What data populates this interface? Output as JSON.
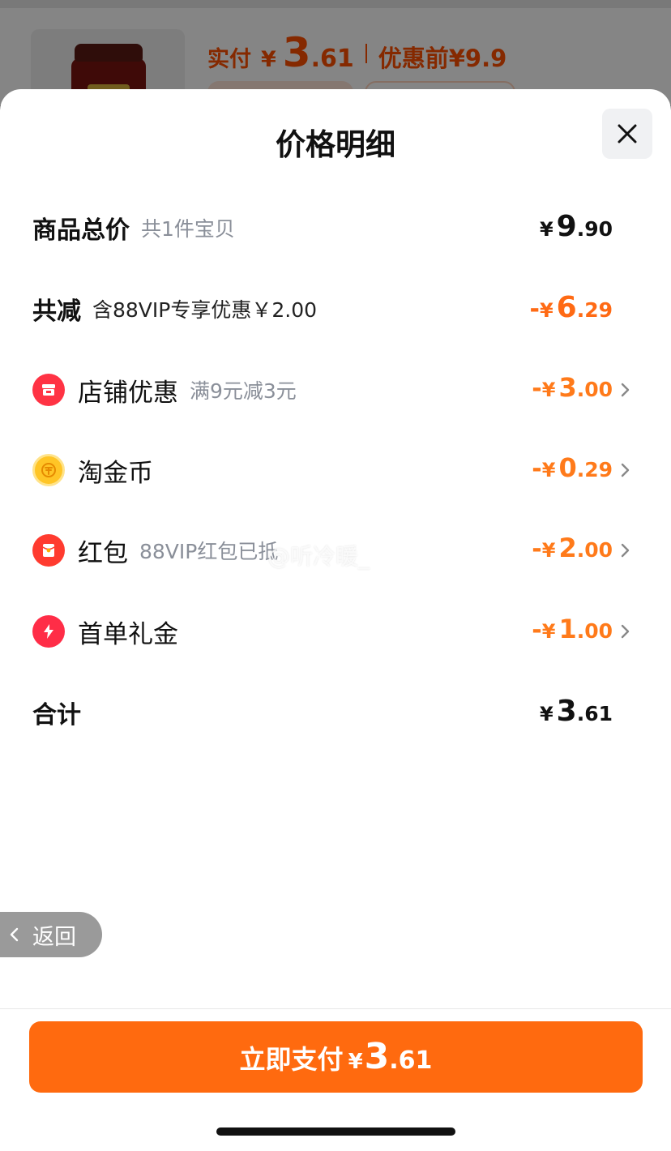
{
  "background": {
    "price_label": "实付",
    "price_yen": "¥",
    "price_int": "3",
    "price_dec": ".61",
    "original_label": "优惠前¥9.9"
  },
  "sheet": {
    "title": "价格明细",
    "close_icon": "close-icon"
  },
  "rows": {
    "total": {
      "label": "商品总价",
      "sub": "共1件宝贝",
      "yen": "¥",
      "int": "9",
      "dec": ".90"
    },
    "discount": {
      "label": "共减",
      "sub": "含88VIP专享优惠￥2.00",
      "minus": "-",
      "yen": "¥",
      "int": "6",
      "dec": ".29"
    },
    "store": {
      "icon": "store-icon",
      "label": "店铺优惠",
      "sub": "满9元减3元",
      "minus": "-",
      "yen": "¥",
      "int": "3",
      "dec": ".00"
    },
    "coin": {
      "icon": "coin-icon",
      "label": "淘金币",
      "sub": "",
      "minus": "-",
      "yen": "¥",
      "int": "0",
      "dec": ".29"
    },
    "hongbao": {
      "icon": "red-envelope-icon",
      "label": "红包",
      "sub": "88VIP红包已抵",
      "minus": "-",
      "yen": "¥",
      "int": "2",
      "dec": ".00"
    },
    "first_order": {
      "icon": "lightning-icon",
      "label": "首单礼金",
      "sub": "",
      "minus": "-",
      "yen": "¥",
      "int": "1",
      "dec": ".00"
    },
    "sum": {
      "label": "合计",
      "yen": "¥",
      "int": "3",
      "dec": ".61"
    }
  },
  "watermark": "@听冷暖_",
  "back": {
    "label": "返回"
  },
  "pay": {
    "label": "立即支付",
    "yen": "¥",
    "int": "3",
    "dec": ".61"
  },
  "colors": {
    "accent": "#ff6a0f",
    "discount": "#ff6a14",
    "muted": "#8a8f99"
  }
}
